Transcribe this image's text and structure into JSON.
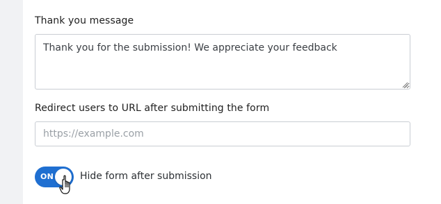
{
  "thank_you": {
    "label": "Thank you message",
    "value": "Thank you for the submission! We appreciate your feedback"
  },
  "redirect": {
    "label": "Redirect users to URL after submitting the form",
    "placeholder": "https://example.com",
    "value": ""
  },
  "hide_form": {
    "toggle_state_text": "ON",
    "label": "Hide form after submission",
    "enabled": true
  },
  "colors": {
    "accent": "#1f6fd1",
    "background_strip": "#f1f2f4",
    "border": "#c9cdd3"
  },
  "icons": {
    "cursor": "pointer-hand-icon",
    "resize": "resize-grip-icon"
  }
}
